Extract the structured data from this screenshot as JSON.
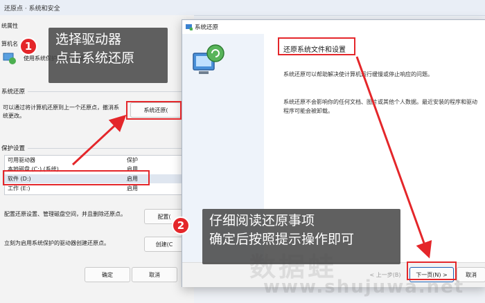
{
  "background_window": {
    "breadcrumb": "还原点 · 系统和安全",
    "dialog_title": "统属性",
    "computer_name_label": "算机名",
    "protection_intro": "使用系统保护撤消不需要的系统更改。",
    "restore_section": "系统还原",
    "restore_description_1": "可以通过将计算机还原到上一个还原点，撤消系",
    "restore_description_2": "统更改。",
    "system_restore_button": "系统还原(",
    "protection_section": "保护设置",
    "table_headers": {
      "drive": "可用驱动器",
      "protection": "保护"
    },
    "drives": [
      {
        "name": "本地磁盘 (C:) (系统)",
        "status": "启用"
      },
      {
        "name": "软件 (D:)",
        "status": "启用"
      },
      {
        "name": "工作 (E:)",
        "status": "启用"
      }
    ],
    "configure_text": "配置还原设置、管理磁盘空间，并且删除还原点。",
    "configure_button": "配置(",
    "create_text": "立刻为启用系统保护的驱动器创建还原点。",
    "create_button": "创建(C",
    "ok_button": "确定",
    "cancel_button": "取消"
  },
  "wizard": {
    "title": "系统还原",
    "heading": "还原系统文件和设置",
    "paragraph_1": "系统还原可以帮助解决使计算机运行缓慢或停止响应的问题。",
    "paragraph_2a": "系统还原不会影响你的任何文档、图片或其他个人数据。最近安装的程序和驱动",
    "paragraph_2b": "程序可能会被卸载。",
    "back_button": "< 上一步(B)",
    "next_button": "下一页(N) >",
    "cancel_button": "取消"
  },
  "annotations": {
    "step1_badge": "1",
    "step1_line1": "选择驱动器",
    "step1_line2": "点击系统还原",
    "step2_badge": "2",
    "step2_line1": "仔细阅读还原事项",
    "step2_line2": "确定后按照提示操作即可",
    "accent": "#e4262a"
  },
  "watermark": {
    "text": "数据蛙",
    "url": "www.shujuwa.net"
  }
}
